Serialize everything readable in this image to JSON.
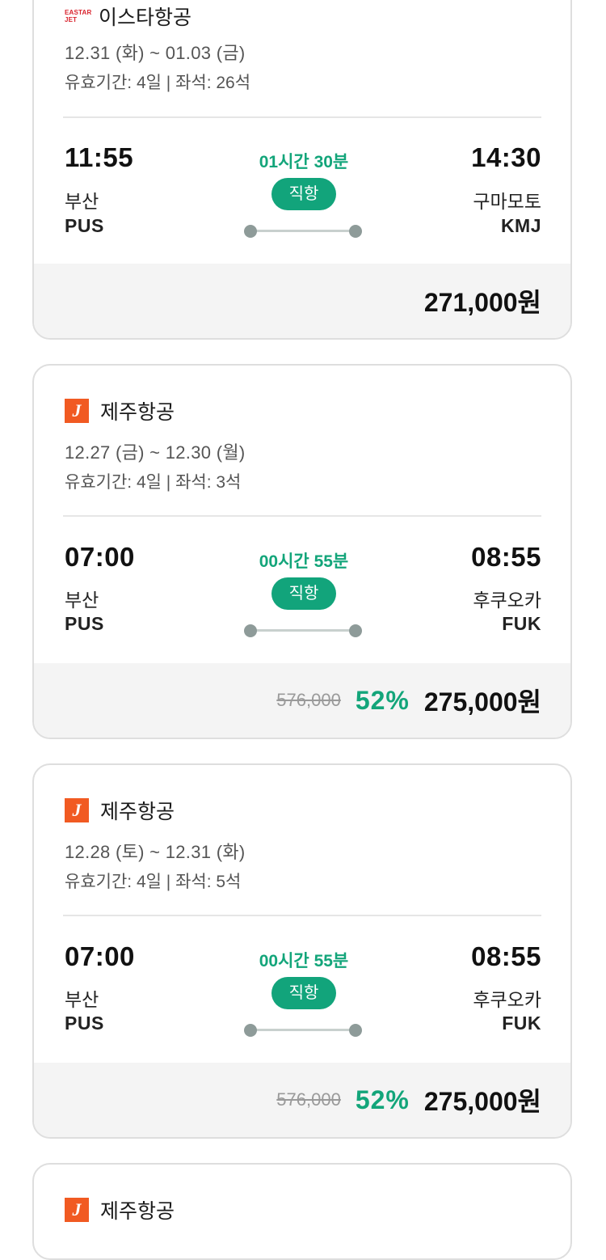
{
  "tickets": [
    {
      "airline": "이스타항공",
      "logo_text": "EASTAR JET",
      "dates": "12.31 (화) ~ 01.03 (금)",
      "validity": "유효기간: 4일 | 좌석: 26석",
      "dep_time": "11:55",
      "dep_city": "부산",
      "dep_code": "PUS",
      "duration": "01시간 30분",
      "direct_label": "직항",
      "arr_time": "14:30",
      "arr_city": "구마모토",
      "arr_code": "KMJ",
      "price": "271,000원"
    },
    {
      "airline": "제주항공",
      "logo_text": "J",
      "dates": "12.27 (금) ~ 12.30 (월)",
      "validity": "유효기간: 4일 | 좌석: 3석",
      "dep_time": "07:00",
      "dep_city": "부산",
      "dep_code": "PUS",
      "duration": "00시간 55분",
      "direct_label": "직항",
      "arr_time": "08:55",
      "arr_city": "후쿠오카",
      "arr_code": "FUK",
      "original_price": "576,000",
      "discount": "52%",
      "price": "275,000원"
    },
    {
      "airline": "제주항공",
      "logo_text": "J",
      "dates": "12.28 (토) ~ 12.31 (화)",
      "validity": "유효기간: 4일 | 좌석: 5석",
      "dep_time": "07:00",
      "dep_city": "부산",
      "dep_code": "PUS",
      "duration": "00시간 55분",
      "direct_label": "직항",
      "arr_time": "08:55",
      "arr_city": "후쿠오카",
      "arr_code": "FUK",
      "original_price": "576,000",
      "discount": "52%",
      "price": "275,000원"
    },
    {
      "airline": "제주항공",
      "logo_text": "J"
    }
  ],
  "colors": {
    "accent_green": "#13a57a",
    "jeju_orange": "#f15a22",
    "eastar_red": "#d9232d"
  }
}
